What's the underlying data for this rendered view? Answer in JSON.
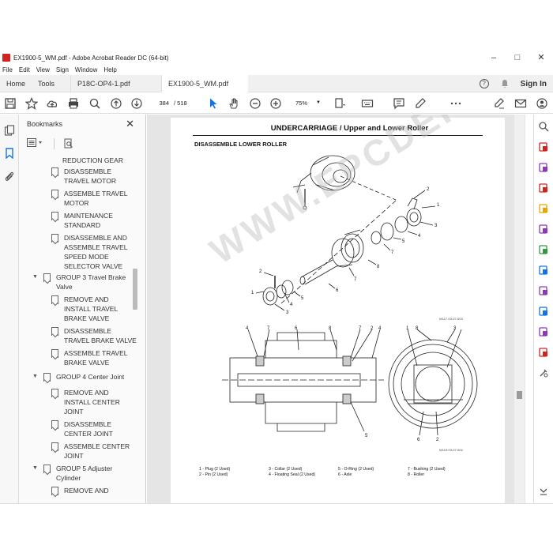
{
  "window": {
    "title": "EX1900-5_WM.pdf - Adobe Acrobat Reader DC (64-bit)",
    "minimize": "–",
    "maximize": "□",
    "close": "✕"
  },
  "menu": [
    "File",
    "Edit",
    "View",
    "Sign",
    "Window",
    "Help"
  ],
  "tabs": {
    "home": "Home",
    "tools": "Tools",
    "docs": [
      {
        "label": "P18C-OP4-1.pdf",
        "close": "×"
      },
      {
        "label": "EX1900-5_WM.pdf",
        "close": "×"
      }
    ],
    "help_icon": "?",
    "signin": "Sign In"
  },
  "toolbar": {
    "page_current": "384",
    "page_count": "/ 518",
    "zoom": "75%",
    "zoom_caret": "▼"
  },
  "bookmarks": {
    "header": "Bookmarks",
    "close": "✕",
    "items": [
      {
        "label": "REDUCTION GEAR",
        "level": 2
      },
      {
        "label": "DISASSEMBLE\nTRAVEL MOTOR",
        "level": 2
      },
      {
        "label": "ASSEMBLE TRAVEL\nMOTOR",
        "level": 2
      },
      {
        "label": "MAINTENANCE\nSTANDARD",
        "level": 2
      },
      {
        "label": "DISASSEMBLE AND\nASSEMBLE TRAVEL\nSPEED MODE\nSELECTOR VALVE",
        "level": 2
      },
      {
        "label": "GROUP 3 Travel Brake\nValve",
        "level": 1,
        "chevron": "▼"
      },
      {
        "label": "REMOVE AND\nINSTALL TRAVEL\nBRAKE  VALVE",
        "level": 2
      },
      {
        "label": "DISASSEMBLE\nTRAVEL BRAKE VALVE",
        "level": 2
      },
      {
        "label": "ASSEMBLE TRAVEL\nBRAKE VALVE",
        "level": 2
      },
      {
        "label": "GROUP 4 Center Joint",
        "level": 1,
        "chevron": "▼"
      },
      {
        "label": "REMOVE AND\nINSTALL CENTER\nJOINT",
        "level": 2
      },
      {
        "label": "DISASSEMBLE\nCENTER JOINT",
        "level": 2
      },
      {
        "label": "ASSEMBLE CENTER\nJOINT",
        "level": 2
      },
      {
        "label": "GROUP 5 Adjuster\nCylinder",
        "level": 1,
        "chevron": "▼"
      },
      {
        "label": "REMOVE AND",
        "level": 2
      }
    ]
  },
  "document": {
    "header": "UNDERCARRIAGE / Upper and Lower Roller",
    "subtitle": "DISASSEMBLE LOWER ROLLER",
    "watermark": "WWW.EPCDEPO.COM",
    "fig1_code": "W117-03-07-003",
    "fig2_code": "W119-03-07-004",
    "legend": [
      [
        "1 -  Plug (2 Used)",
        "2 -  Pin (2 Used)"
      ],
      [
        "3 -  Collar (2 Used)",
        "4 -  Floating Seal (2 Used)"
      ],
      [
        "5 -  O-Ring (2 Used)",
        "6 -  Axle"
      ],
      [
        "7 -  Bushing (2 Used)",
        "8 -  Roller"
      ]
    ],
    "callouts": {
      "fig1": [
        "2",
        "1",
        "3",
        "4",
        "5",
        "7",
        "8",
        "7",
        "6",
        "2",
        "1",
        "3",
        "4",
        "5"
      ],
      "fig2": [
        "4",
        "7",
        "6",
        "8",
        "7",
        "2",
        "4",
        "3",
        "5",
        "1",
        "8",
        "3",
        "6",
        "2"
      ]
    }
  },
  "icons": {
    "left_rail": [
      "pages-icon",
      "bookmark-icon",
      "attachment-icon"
    ],
    "right_rail": [
      "search-zoom-icon",
      "create-pdf-icon",
      "organize-pages-icon",
      "export-pdf-icon",
      "comment-icon",
      "edit-pdf-icon",
      "compress-pdf-icon",
      "scan-icon",
      "fill-sign-icon",
      "protect-icon",
      "send-for-signature-icon",
      "prepare-form-icon",
      "more-tools-icon",
      "expand-icon"
    ]
  },
  "colors": {
    "accent_red": "#d2231f",
    "accent_blue": "#1473e6",
    "rail_purple": "#8a3ab9",
    "rail_green": "#2f9a42"
  }
}
